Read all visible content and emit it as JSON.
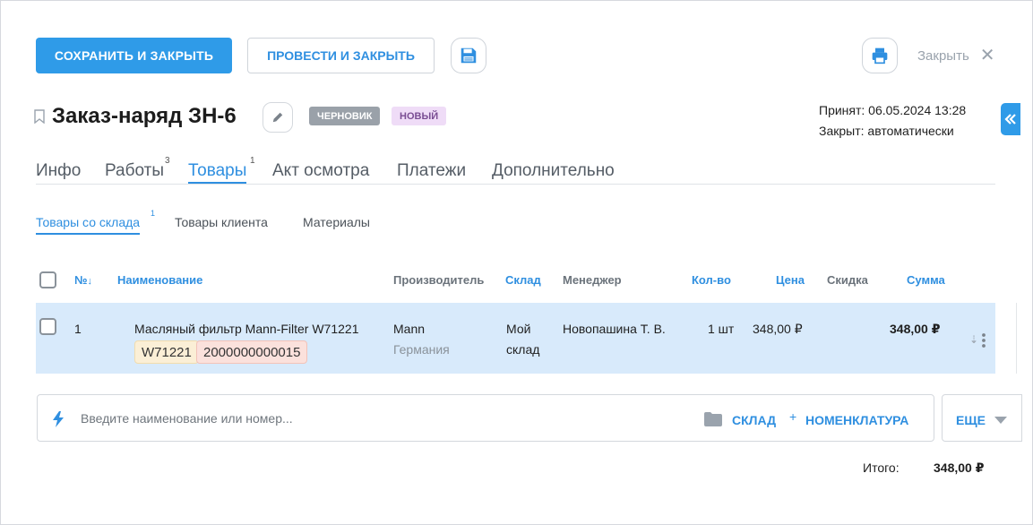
{
  "toolbar": {
    "save_close_label": "СОХРАНИТЬ И ЗАКРЫТЬ",
    "post_close_label": "ПРОВЕСТИ И ЗАКРЫТЬ",
    "close_label": "Закрыть"
  },
  "header": {
    "title": "Заказ-наряд ЗН-6",
    "badges": [
      "ЧЕРНОВИК",
      "НОВЫЙ"
    ],
    "accepted": "Принят: 06.05.2024 13:28",
    "closed": "Закрыт: автоматически"
  },
  "tabs": [
    {
      "label": "Инфо",
      "count": ""
    },
    {
      "label": "Работы",
      "count": "3"
    },
    {
      "label": "Товары",
      "count": "1"
    },
    {
      "label": "Акт осмотра",
      "count": ""
    },
    {
      "label": "Платежи",
      "count": ""
    },
    {
      "label": "Дополнительно",
      "count": ""
    }
  ],
  "subtabs": [
    {
      "label": "Товары со склада",
      "count": "1"
    },
    {
      "label": "Товары клиента",
      "count": ""
    },
    {
      "label": "Материалы",
      "count": ""
    }
  ],
  "table": {
    "columns": [
      "№",
      "Наименование",
      "Производитель",
      "Склад",
      "Менеджер",
      "Кол-во",
      "Цена",
      "Скидка",
      "Сумма"
    ],
    "rows": [
      {
        "num": "1",
        "name": "Масляный фильтр Mann-Filter W71221",
        "article": "W71221",
        "code": "2000000000015",
        "maker": "Mann",
        "country": "Германия",
        "warehouse_line1": "Мой",
        "warehouse_line2": "склад",
        "manager": "Новопашина Т. В.",
        "qty": "1 шт",
        "price": "348,00 ₽",
        "discount": "",
        "sum": "348,00 ₽"
      }
    ]
  },
  "search": {
    "placeholder": "Введите наименование или номер...",
    "warehouse_link": "СКЛАД",
    "plus": "+",
    "nomenclature_link": "НОМЕНКЛАТУРА",
    "more_label": "ЕЩЕ"
  },
  "totals": {
    "label": "Итого:",
    "value": "348,00 ₽"
  },
  "colors": {
    "accent": "#2f9be8",
    "row_selected": "#d8eafb",
    "badge_draft": "#9aa1a9",
    "badge_new": "#efdcf7"
  }
}
